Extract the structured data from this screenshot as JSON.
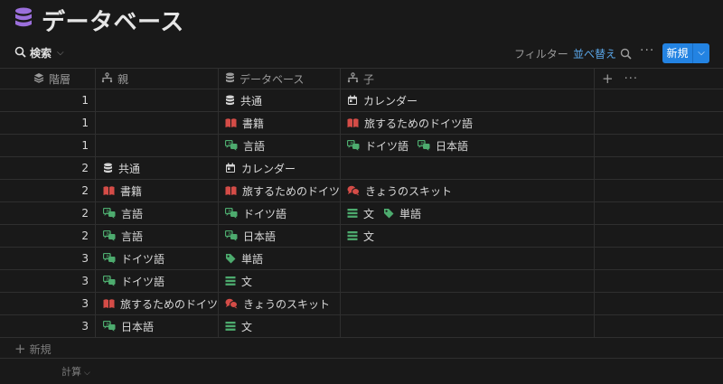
{
  "page": {
    "title": "データベース",
    "icon": "database-icon",
    "icon_color": "#9b6fdc"
  },
  "toolbar": {
    "search_label": "検索",
    "filter_label": "フィルター",
    "sort_label": "並べ替え",
    "new_label": "新規",
    "accent_color": "#2383e2",
    "sort_color": "#5aa6e8"
  },
  "columns": [
    {
      "key": "level",
      "label": "階層",
      "icon": "layers-icon"
    },
    {
      "key": "parent",
      "label": "親",
      "icon": "relation-icon"
    },
    {
      "key": "database",
      "label": "データベース",
      "icon": "database-icon"
    },
    {
      "key": "child",
      "label": "子",
      "icon": "relation-icon"
    }
  ],
  "icon_colors": {
    "common": "#d4d4d4",
    "calendar": "#d4d4d4",
    "book": "#d44c47",
    "language": "#4dab6e",
    "skit": "#d44c47",
    "list": "#4dab6e",
    "tag": "#4dab6e"
  },
  "rows": [
    {
      "level": "1",
      "parent": [],
      "database": [
        {
          "name": "共通",
          "icon": "common"
        }
      ],
      "child": [
        {
          "name": "カレンダー",
          "icon": "calendar"
        }
      ]
    },
    {
      "level": "1",
      "parent": [],
      "database": [
        {
          "name": "書籍",
          "icon": "book"
        }
      ],
      "child": [
        {
          "name": "旅するためのドイツ語",
          "icon": "book"
        }
      ]
    },
    {
      "level": "1",
      "parent": [],
      "database": [
        {
          "name": "言語",
          "icon": "language"
        }
      ],
      "child": [
        {
          "name": "ドイツ語",
          "icon": "language"
        },
        {
          "name": "日本語",
          "icon": "language"
        }
      ]
    },
    {
      "level": "2",
      "parent": [
        {
          "name": "共通",
          "icon": "common"
        }
      ],
      "database": [
        {
          "name": "カレンダー",
          "icon": "calendar"
        }
      ],
      "child": []
    },
    {
      "level": "2",
      "parent": [
        {
          "name": "書籍",
          "icon": "book"
        }
      ],
      "database": [
        {
          "name": "旅するためのドイツ語",
          "icon": "book"
        }
      ],
      "child": [
        {
          "name": "きょうのスキット",
          "icon": "skit"
        }
      ]
    },
    {
      "level": "2",
      "parent": [
        {
          "name": "言語",
          "icon": "language"
        }
      ],
      "database": [
        {
          "name": "ドイツ語",
          "icon": "language"
        }
      ],
      "child": [
        {
          "name": "文",
          "icon": "list"
        },
        {
          "name": "単語",
          "icon": "tag"
        }
      ]
    },
    {
      "level": "2",
      "parent": [
        {
          "name": "言語",
          "icon": "language"
        }
      ],
      "database": [
        {
          "name": "日本語",
          "icon": "language"
        }
      ],
      "child": [
        {
          "name": "文",
          "icon": "list"
        }
      ]
    },
    {
      "level": "3",
      "parent": [
        {
          "name": "ドイツ語",
          "icon": "language"
        }
      ],
      "database": [
        {
          "name": "単語",
          "icon": "tag"
        }
      ],
      "child": []
    },
    {
      "level": "3",
      "parent": [
        {
          "name": "ドイツ語",
          "icon": "language"
        }
      ],
      "database": [
        {
          "name": "文",
          "icon": "list"
        }
      ],
      "child": []
    },
    {
      "level": "3",
      "parent": [
        {
          "name": "旅するためのドイツ語",
          "icon": "book"
        }
      ],
      "database": [
        {
          "name": "きょうのスキット",
          "icon": "skit"
        }
      ],
      "child": []
    },
    {
      "level": "3",
      "parent": [
        {
          "name": "日本語",
          "icon": "language"
        }
      ],
      "database": [
        {
          "name": "文",
          "icon": "list"
        }
      ],
      "child": []
    }
  ],
  "footer": {
    "new_row_label": "新規",
    "calc_label": "計算"
  }
}
